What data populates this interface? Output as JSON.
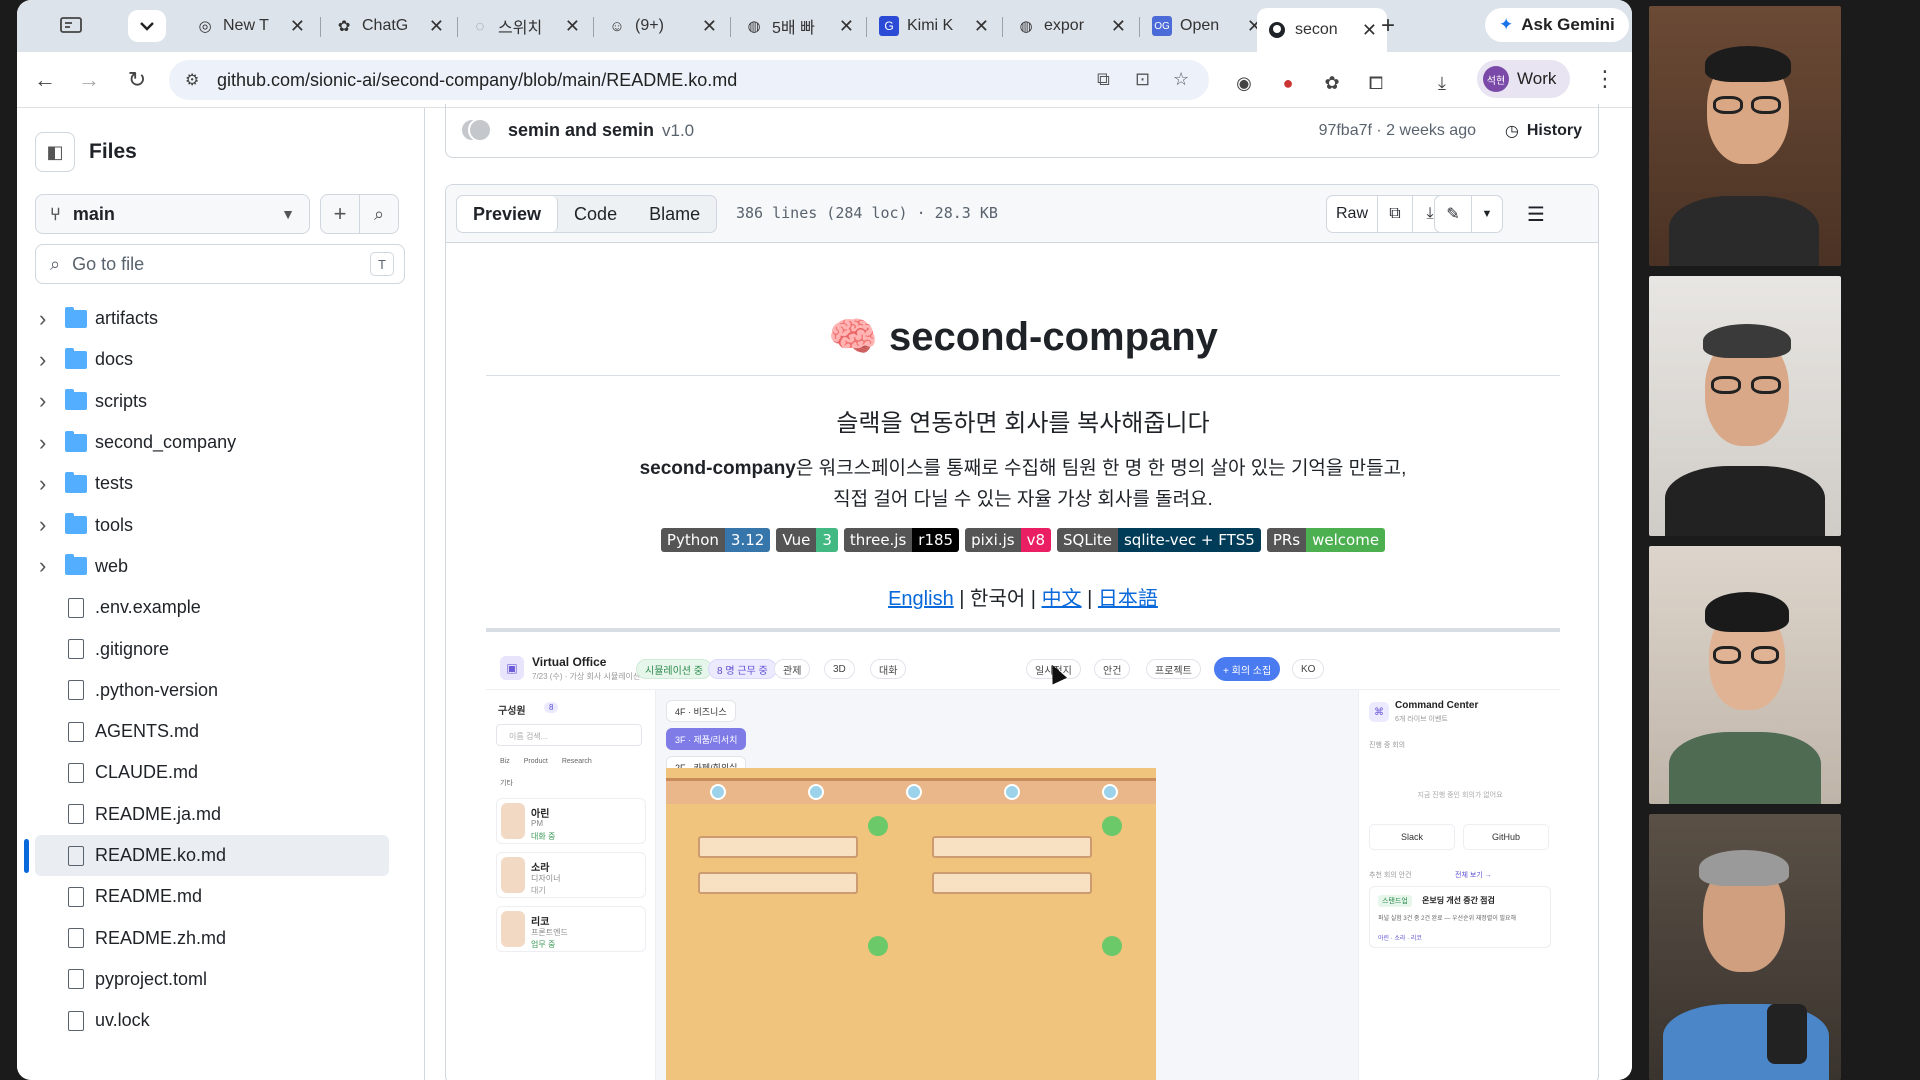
{
  "browser": {
    "tabs": [
      {
        "title": "New T",
        "icon": "chrome-icon"
      },
      {
        "title": "ChatG",
        "icon": "openai-icon"
      },
      {
        "title": "스위치",
        "icon": "switch-icon"
      },
      {
        "title": "(9+) ",
        "icon": "person-icon"
      },
      {
        "title": "5배 빠",
        "icon": "globe-icon"
      },
      {
        "title": "Kimi K",
        "icon": "kimi-icon"
      },
      {
        "title": "expor",
        "icon": "globe-icon"
      },
      {
        "title": "Open",
        "icon": "og-icon"
      },
      {
        "title": "secon",
        "icon": "github-icon",
        "active": true
      }
    ],
    "gemini_label": "Ask Gemini",
    "url": "github.com/sionic-ai/second-company/blob/main/README.ko.md",
    "profile_label": "Work",
    "profile_initials": "석현"
  },
  "sidebar": {
    "title": "Files",
    "branch": "main",
    "goto_placeholder": "Go to file",
    "goto_shortcut": "T",
    "items": [
      {
        "label": "artifacts",
        "type": "folder"
      },
      {
        "label": "docs",
        "type": "folder"
      },
      {
        "label": "scripts",
        "type": "folder"
      },
      {
        "label": "second_company",
        "type": "folder"
      },
      {
        "label": "tests",
        "type": "folder"
      },
      {
        "label": "tools",
        "type": "folder"
      },
      {
        "label": "web",
        "type": "folder"
      },
      {
        "label": ".env.example",
        "type": "file"
      },
      {
        "label": ".gitignore",
        "type": "file"
      },
      {
        "label": ".python-version",
        "type": "file"
      },
      {
        "label": "AGENTS.md",
        "type": "file"
      },
      {
        "label": "CLAUDE.md",
        "type": "file"
      },
      {
        "label": "README.ja.md",
        "type": "file"
      },
      {
        "label": "README.ko.md",
        "type": "file",
        "selected": true
      },
      {
        "label": "README.md",
        "type": "file"
      },
      {
        "label": "README.zh.md",
        "type": "file"
      },
      {
        "label": "pyproject.toml",
        "type": "file"
      },
      {
        "label": "uv.lock",
        "type": "file"
      }
    ]
  },
  "commit": {
    "authors": "semin and semin",
    "version": "v1.0",
    "meta": "97fba7f · 2 weeks ago",
    "history_label": "History"
  },
  "file_header": {
    "tabs": [
      "Preview",
      "Code",
      "Blame"
    ],
    "active_tab": "Preview",
    "info": "386 lines (284 loc) · 28.3 KB",
    "raw_label": "Raw"
  },
  "readme": {
    "title": "🧠 second-company",
    "subtitle": "슬랙을 연동하면 회사를 복사해줍니다",
    "desc_bold": "second-company",
    "desc_line1": "은 워크스페이스를 통째로 수집해 팀원 한 명 한 명의 살아 있는 기억을 만들고,",
    "desc_line2": "직접 걸어 다닐 수 있는 자율 가상 회사를 돌려요.",
    "badges": [
      {
        "label": "Python",
        "value": "3.12",
        "color": "#3776ab"
      },
      {
        "label": "Vue",
        "value": "3",
        "color": "#42b883"
      },
      {
        "label": "three.js",
        "value": "r185",
        "color": "#000000"
      },
      {
        "label": "pixi.js",
        "value": "v8",
        "color": "#e91e63"
      },
      {
        "label": "SQLite",
        "value": "sqlite-vec + FTS5",
        "color": "#003b57"
      },
      {
        "label": "PRs",
        "value": "welcome",
        "color": "#4caf50"
      }
    ],
    "langs": {
      "en": "English",
      "ko": "한국어",
      "zh": "中文",
      "ja": "日本語",
      "sep": "|"
    }
  },
  "virtual_office": {
    "title": "Virtual Office",
    "subtitle": "7/23 (수) · 가상 회사 시뮬레이션",
    "status": "시뮬레이션 중",
    "count": "8 명 근무 중",
    "nav": [
      "관제",
      "3D",
      "대화"
    ],
    "actions": [
      "일시정지",
      "안건",
      "프로젝트",
      "+ 회의 소집",
      "KO"
    ],
    "members_title": "구성원",
    "members_count": "8",
    "search_placeholder": "이름 검색...",
    "filters": [
      "Biz",
      "Product",
      "Research",
      "기타"
    ],
    "floors": [
      "4F · 비즈니스",
      "3F · 제품/리서치",
      "2F · 카페/회의실"
    ],
    "members": [
      {
        "name": "아린",
        "role": "PM",
        "status": "대화 중"
      },
      {
        "name": "소라",
        "role": "디자이너",
        "status": "대기"
      },
      {
        "name": "리코",
        "role": "프론트엔드",
        "status": "업무 중"
      }
    ],
    "command_title": "Command Center",
    "command_sub": "6개 라이브 이벤트",
    "meeting_label": "진행 중 회의",
    "empty_meeting": "지금 진행 중인 회의가 없어요",
    "slack": "Slack",
    "github": "GitHub",
    "agenda_label": "추천 회의 안건",
    "agenda_link": "전체 보기 →",
    "agenda_tag": "스탠드업",
    "agenda_title": "온보딩 개선 중간 점검",
    "agenda_desc": "퍼널 실험 3건 중 2건 완료 — 우선순위 재정렬이 필요해",
    "agenda_people": "아린 · 소라 · 리코"
  },
  "colors": {
    "accent": "#0969da",
    "folder": "#54aeff",
    "gemini": "#1a73e8"
  }
}
